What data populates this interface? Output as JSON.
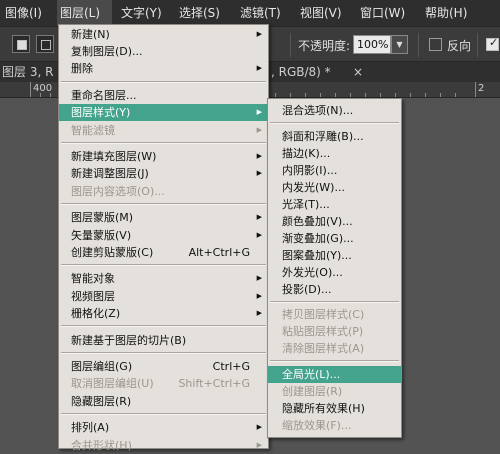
{
  "menubar": {
    "items": [
      "图像(I)",
      "图层(L)",
      "文字(Y)",
      "选择(S)",
      "滤镜(T)",
      "视图(V)",
      "窗口(W)",
      "帮助(H)"
    ]
  },
  "options_bar": {
    "opacity_label": "不透明度:",
    "opacity_value": "100%",
    "reverse_label": "反向",
    "reverse_checked": false
  },
  "doc_tab": {
    "title_left": "图层 3, R",
    "title_right": ", RGB/8) *",
    "close_glyph": "×"
  },
  "ruler": {
    "labels": [
      "400",
      "2"
    ]
  },
  "layer_menu": {
    "items": [
      {
        "label": "新建(N)",
        "submenu": true
      },
      {
        "label": "复制图层(D)..."
      },
      {
        "label": "删除",
        "submenu": true
      },
      {
        "sep": true
      },
      {
        "label": "重命名图层..."
      },
      {
        "label": "图层样式(Y)",
        "submenu": true,
        "highlighted": true
      },
      {
        "label": "智能滤镜",
        "submenu": true,
        "disabled": true
      },
      {
        "sep": true
      },
      {
        "label": "新建填充图层(W)",
        "submenu": true
      },
      {
        "label": "新建调整图层(J)",
        "submenu": true
      },
      {
        "label": "图层内容选项(O)...",
        "disabled": true
      },
      {
        "sep": true
      },
      {
        "label": "图层蒙版(M)",
        "submenu": true
      },
      {
        "label": "矢量蒙版(V)",
        "submenu": true
      },
      {
        "label": "创建剪贴蒙版(C)",
        "shortcut": "Alt+Ctrl+G"
      },
      {
        "sep": true
      },
      {
        "label": "智能对象",
        "submenu": true
      },
      {
        "label": "视频图层",
        "submenu": true
      },
      {
        "label": "栅格化(Z)",
        "submenu": true
      },
      {
        "sep": true
      },
      {
        "label": "新建基于图层的切片(B)"
      },
      {
        "sep": true
      },
      {
        "label": "图层编组(G)",
        "shortcut": "Ctrl+G"
      },
      {
        "label": "取消图层编组(U)",
        "shortcut": "Shift+Ctrl+G",
        "disabled": true
      },
      {
        "label": "隐藏图层(R)"
      },
      {
        "sep": true
      },
      {
        "label": "排列(A)",
        "submenu": true
      },
      {
        "label": "合并形状(H)",
        "submenu": true,
        "disabled": true
      }
    ]
  },
  "style_submenu": {
    "items": [
      {
        "label": "混合选项(N)..."
      },
      {
        "sep": true
      },
      {
        "label": "斜面和浮雕(B)..."
      },
      {
        "label": "描边(K)..."
      },
      {
        "label": "内阴影(I)..."
      },
      {
        "label": "内发光(W)..."
      },
      {
        "label": "光泽(T)..."
      },
      {
        "label": "颜色叠加(V)..."
      },
      {
        "label": "渐变叠加(G)..."
      },
      {
        "label": "图案叠加(Y)..."
      },
      {
        "label": "外发光(O)..."
      },
      {
        "label": "投影(D)..."
      },
      {
        "sep": true
      },
      {
        "label": "拷贝图层样式(C)",
        "disabled": true
      },
      {
        "label": "粘贴图层样式(P)",
        "disabled": true
      },
      {
        "label": "清除图层样式(A)",
        "disabled": true
      },
      {
        "sep": true
      },
      {
        "label": "全局光(L)...",
        "highlighted": true
      },
      {
        "label": "创建图层(R)",
        "disabled": true
      },
      {
        "label": "隐藏所有效果(H)"
      },
      {
        "label": "缩放效果(F)...",
        "disabled": true
      }
    ]
  },
  "colors": {
    "highlight": "#44a38d",
    "menu_bg": "#e4e1dc",
    "disabled_text": "#9a978f",
    "app_bg": "#535353"
  }
}
